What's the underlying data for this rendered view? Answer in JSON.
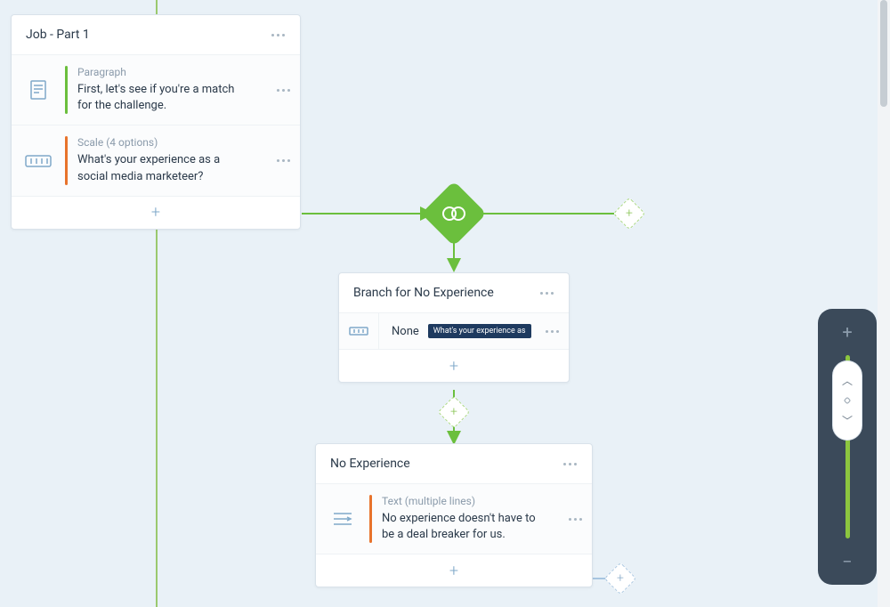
{
  "colors": {
    "green": "#6bbf3d",
    "orange": "#e8732c",
    "blue_text": "#2b3a4a",
    "muted": "#8b9bab"
  },
  "card_job": {
    "title": "Job - Part 1",
    "items": [
      {
        "type": "Paragraph",
        "text": "First, let's see if you're a match for the challenge.",
        "accent": "green",
        "icon": "doc"
      },
      {
        "type": "Scale (4 options)",
        "text": "What's your experience as a social media marketeer?",
        "accent": "orange",
        "icon": "scale"
      }
    ]
  },
  "card_branch": {
    "title": "Branch for No Experience",
    "condition": {
      "value": "None",
      "chip": "What's your experience as"
    }
  },
  "card_noexp": {
    "title": "No Experience",
    "items": [
      {
        "type": "Text (multiple lines)",
        "text": "No experience doesn't have to be a deal breaker for us.",
        "accent": "orange",
        "icon": "text"
      }
    ]
  },
  "zoom": {
    "plus": "+",
    "minus": "−"
  }
}
